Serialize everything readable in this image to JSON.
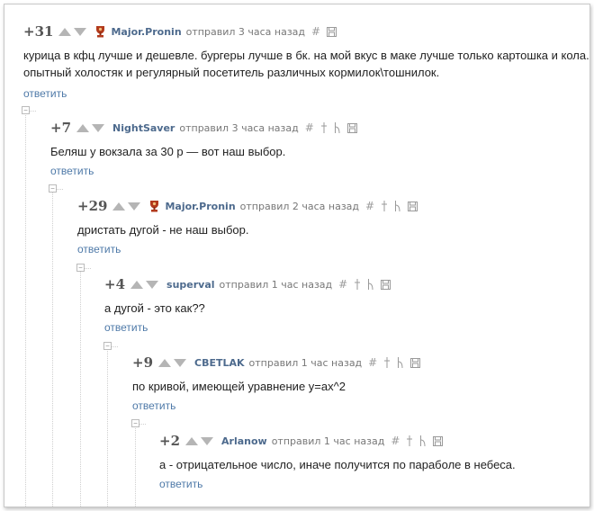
{
  "comments": [
    {
      "rating": "+31",
      "author": "Major.Pronin",
      "meta": "отправил 3 часа назад",
      "text_lines": [
        "курица в кфц лучше и дешевле. бургеры лучше в бк. на мой вкус в маке лучше только картошка и кола.",
        "опытный холостяк и регулярный посетитель различных кормилок\\тошнилок."
      ],
      "reply": "ответить",
      "avatar": "trophy-avatar"
    },
    {
      "rating": "+7",
      "author": "NightSaver",
      "meta": "отправил 3 часа назад",
      "text_lines": [
        "Беляш у вокзала за 30 р — вот наш выбор."
      ],
      "reply": "ответить"
    },
    {
      "rating": "+29",
      "author": "Major.Pronin",
      "meta": "отправил 2 часа назад",
      "text_lines": [
        "дристать дугой - не наш выбор."
      ],
      "reply": "ответить",
      "avatar": "trophy-avatar"
    },
    {
      "rating": "+4",
      "author": "superval",
      "meta": "отправил 1 час назад",
      "text_lines": [
        "а дугой - это как??"
      ],
      "reply": "ответить"
    },
    {
      "rating": "+9",
      "author": "CBETLAK",
      "meta": "отправил 1 час назад",
      "text_lines": [
        "по кривой, имеющей уравнение у=ах^2"
      ],
      "reply": "ответить"
    },
    {
      "rating": "+2",
      "author": "Arlanow",
      "meta": "отправил 1 час назад",
      "text_lines": [
        "а - отрицательное число, иначе получится по параболе в небеса."
      ],
      "reply": "ответить"
    }
  ],
  "icons": {
    "hash": "#",
    "collapse": "⊟"
  },
  "colors": {
    "author": "#4d6a8d",
    "reply_link": "#4e79a8",
    "rating": "#555555"
  }
}
